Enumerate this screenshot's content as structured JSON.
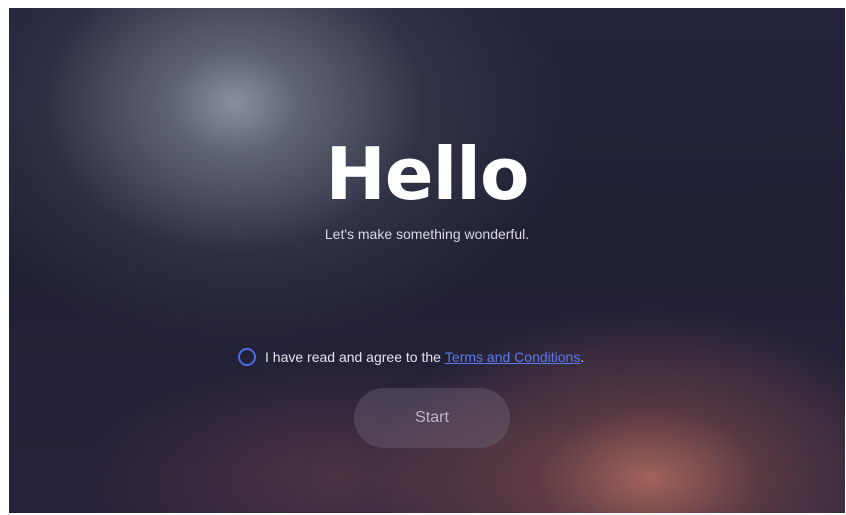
{
  "welcome": {
    "title": "Hello",
    "subtitle": "Let's make something wonderful."
  },
  "agreement": {
    "prefix": "I have read and agree to the",
    "link_text": "Terms and Conditions",
    "suffix": ".",
    "checked": false,
    "accent_color": "#5b79f0",
    "icon": "radio-unchecked-icon"
  },
  "start_button": {
    "label": "Start",
    "enabled": false
  },
  "colors": {
    "background": "#23243a",
    "highlight": "#cd7864",
    "text": "#ffffff"
  }
}
